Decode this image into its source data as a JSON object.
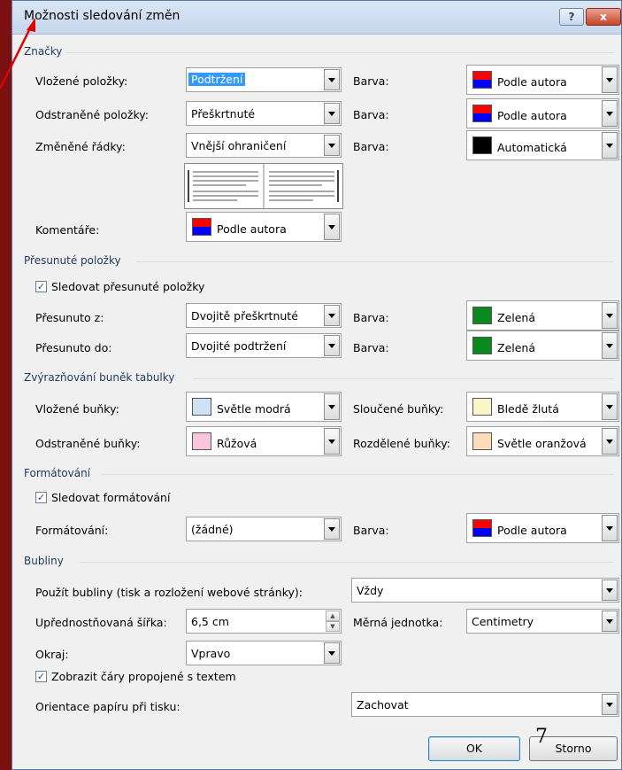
{
  "window": {
    "title": "Možnosti sledování změn",
    "help_label": "?",
    "close_label": "x"
  },
  "sections": {
    "markup": "Značky",
    "moves": "Přesunuté položky",
    "cells": "Zvýrazňování buněk tabulky",
    "formatting": "Formátování",
    "balloons": "Bubliny"
  },
  "markup": {
    "insertions_label": "Vložené položky:",
    "insertions_value": "Podtržení",
    "deletions_label": "Odstraněné položky:",
    "deletions_value": "Přeškrtnuté",
    "changed_lines_label": "Změněné řádky:",
    "changed_lines_value": "Vnější ohraničení",
    "comments_label": "Komentáře:",
    "comments_value": "Podle autora",
    "color_label": "Barva:",
    "insertions_color": "Podle autora",
    "deletions_color": "Podle autora",
    "changed_lines_color": "Automatická"
  },
  "moves": {
    "track_label": "Sledovat přesunuté položky",
    "from_label": "Přesunuto z:",
    "from_value": "Dvojitě přeškrtnuté",
    "to_label": "Přesunuto do:",
    "to_value": "Dvojité podtržení",
    "color_label": "Barva:",
    "from_color": "Zelená",
    "to_color": "Zelená"
  },
  "cells": {
    "inserted_label": "Vložené buňky:",
    "inserted_value": "Světle modrá",
    "deleted_label": "Odstraněné buňky:",
    "deleted_value": "Růžová",
    "merged_label": "Sloučené buňky:",
    "merged_value": "Bledě žlutá",
    "split_label": "Rozdělené buňky:",
    "split_value": "Světle oranžová"
  },
  "formatting": {
    "track_label": "Sledovat formátování",
    "format_label": "Formátování:",
    "format_value": "(žádné)",
    "color_label": "Barva:",
    "color_value": "Podle autora"
  },
  "balloons": {
    "use_label": "Použít bubliny (tisk a rozložení webové stránky):",
    "use_value": "Vždy",
    "width_label": "Upřednostňovaná šířka:",
    "width_value": "6,5 cm",
    "unit_label": "Měrná jednotka:",
    "unit_value": "Centimetry",
    "margin_label": "Okraj:",
    "margin_value": "Vpravo",
    "lines_label": "Zobrazit čáry propojené s textem",
    "orientation_label": "Orientace papíru při tisku:",
    "orientation_value": "Zachovat"
  },
  "buttons": {
    "ok": "OK",
    "cancel": "Storno"
  },
  "annotations": {
    "pen_mark": "7"
  },
  "colors": {
    "background": "#7a1010",
    "green": "#0a8a1e",
    "light_blue": "#cfe3f7",
    "pink": "#f7c6de",
    "light_yellow": "#fbf6c8",
    "light_orange": "#fcdcbc",
    "black": "#000000",
    "author_red": "#ff0000",
    "author_blue": "#0000ff"
  }
}
